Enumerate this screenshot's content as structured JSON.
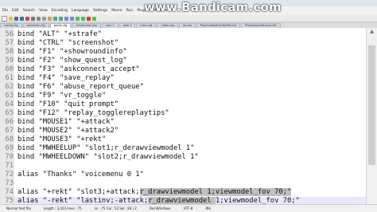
{
  "watermark": "www.Bandicam.com",
  "menu": [
    "File",
    "Edit",
    "Search",
    "View",
    "Encoding",
    "Language",
    "Settings",
    "Macro",
    "Run",
    "Plugins",
    "Window",
    "?"
  ],
  "tabs": [
    "config.cfg",
    "autoexec.cfg",
    "binds.cfg",
    "1channeler.cfg",
    "new 1",
    "new 2",
    "misc.cfg",
    "video.cfg",
    "lol.cfg",
    "PeachsWeatherBotRel.txt",
    "PhoenixeduRunner.txt"
  ],
  "active_tab": 2,
  "lines": [
    {
      "num": "56",
      "text": "bind \"ALT\" \"+strafe\""
    },
    {
      "num": "57",
      "text": "bind \"CTRL\" \"screenshot\""
    },
    {
      "num": "58",
      "text": "bind \"F1\" \"+showroundinfo\""
    },
    {
      "num": "59",
      "text": "bind \"F2\" \"show_quest_log\""
    },
    {
      "num": "60",
      "text": "bind \"F3\" \"askconnect_accept\""
    },
    {
      "num": "61",
      "text": "bind \"F4\" \"save_replay\""
    },
    {
      "num": "62",
      "text": "bind \"F6\" \"abuse_report_queue\""
    },
    {
      "num": "63",
      "text": "bind \"F9\" \"vr_toggle\""
    },
    {
      "num": "64",
      "text": "bind \"F10\" \"quit prompt\""
    },
    {
      "num": "65",
      "text": "bind \"F12\" \"replay_togglereplaytips\""
    },
    {
      "num": "66",
      "text": "bind \"MOUSE1\" \"+attack\""
    },
    {
      "num": "67",
      "text": "bind \"MOUSE2\" \"+attack2\""
    },
    {
      "num": "68",
      "text": "bind \"MOUSE3\" \"+rekt\""
    },
    {
      "num": "69",
      "text": "bind \"MWHEELUP\" \"slot1;r_derawviewmodel 1\""
    },
    {
      "num": "70",
      "text": "bind \"MWHEELDOWN\" \"slot2;r_drawviewmodel 1\""
    },
    {
      "num": "71",
      "text": ""
    },
    {
      "num": "72",
      "text": "alias \"Thanks\" \"voicemenu 0 1\""
    },
    {
      "num": "73",
      "text": ""
    },
    {
      "num": "74",
      "pre": "alias \"+rekt\" \"slot3;+attack;",
      "sel": "r_drawviewmodel 1;viewmodel_fov 70;\"",
      "post": ""
    },
    {
      "num": "75",
      "pre": "alias \"-rekt\" \"lastinv;-attack;",
      "sel": "r_drawviewmodel ",
      "post": "1;viewmodel_fov 70;\""
    }
  ],
  "status": {
    "type": "Normal text file",
    "length": "length : 3,413   lines : 75",
    "position": "Ln : 75   Col : 53   Sel : 84 | 2",
    "eol": "Dos\\Windows",
    "encoding": "UTF-8",
    "mode": "INS"
  }
}
